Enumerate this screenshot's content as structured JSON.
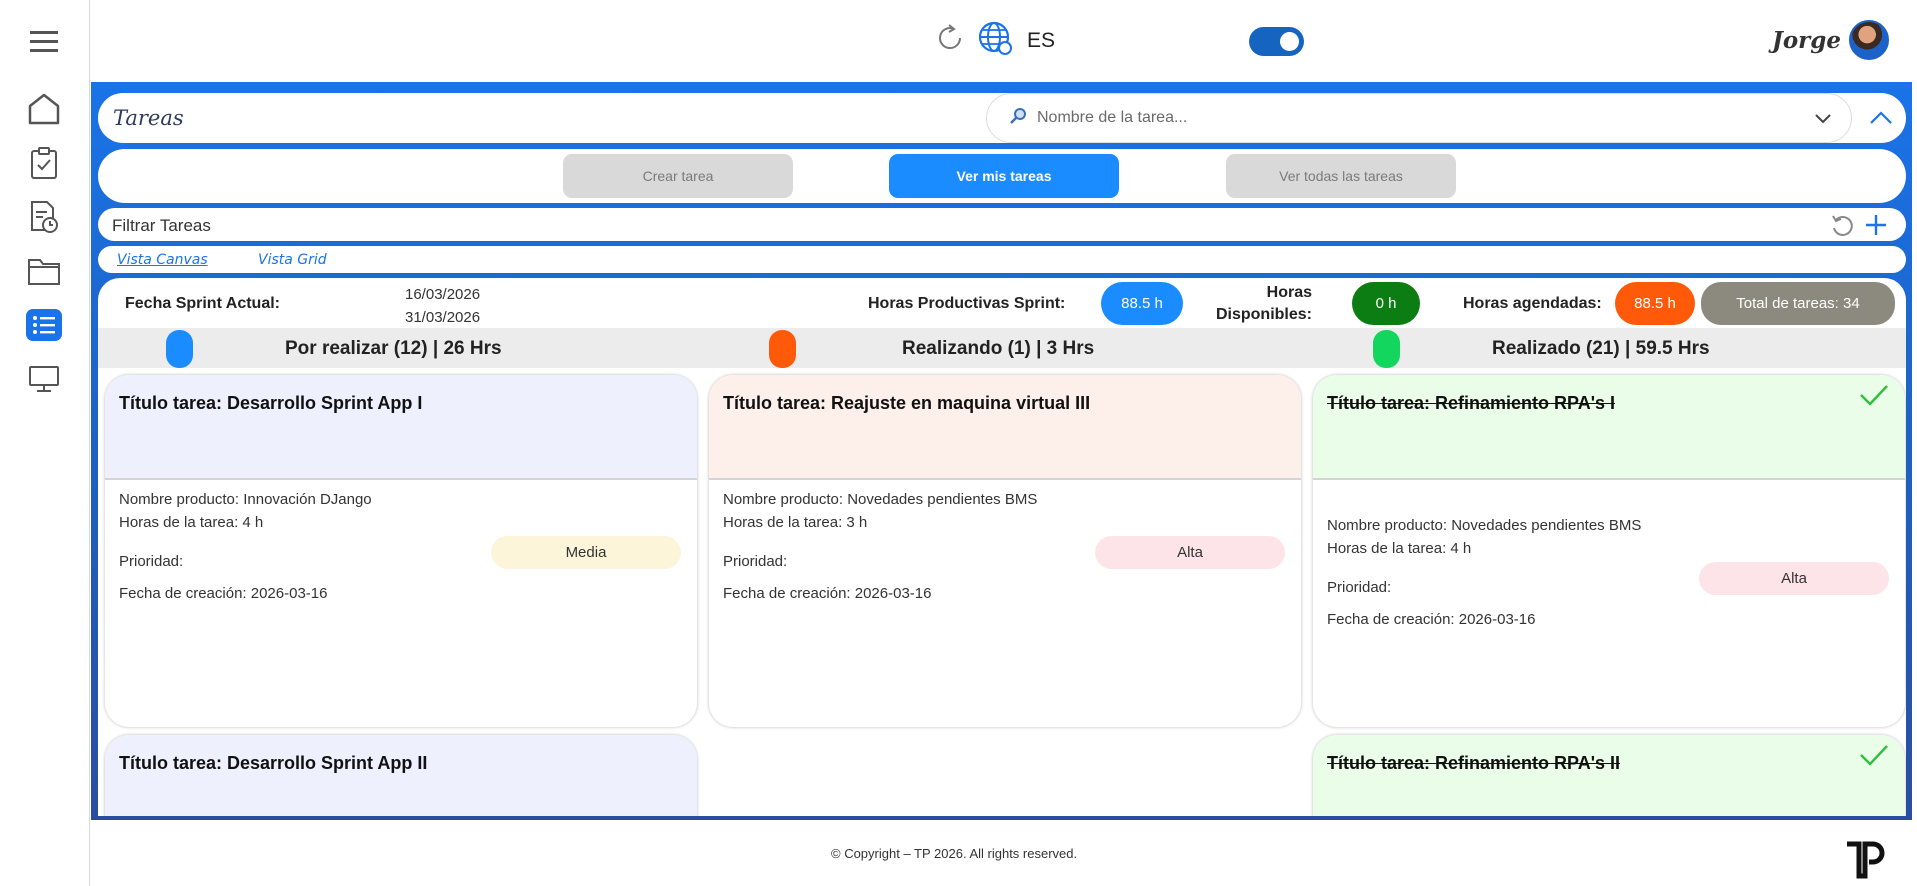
{
  "topbar": {
    "language": "ES",
    "user_name": "Jorge"
  },
  "sidebar": {
    "items": [
      {
        "name": "menu-icon"
      },
      {
        "name": "home-icon"
      },
      {
        "name": "clipboard-check-icon"
      },
      {
        "name": "document-clock-icon"
      },
      {
        "name": "folder-icon"
      },
      {
        "name": "list-icon",
        "active": true
      },
      {
        "name": "monitor-icon"
      }
    ]
  },
  "page": {
    "title": "Tareas",
    "search_placeholder": "Nombre de la tarea..."
  },
  "actions": {
    "create": "Crear tarea",
    "mine": "Ver mis tareas",
    "all": "Ver todas las tareas"
  },
  "filter": {
    "label": "Filtrar Tareas"
  },
  "views": {
    "canvas": "Vista Canvas",
    "grid": "Vista Grid"
  },
  "stats": {
    "sprint_label": "Fecha Sprint Actual:",
    "sprint_start": "16/03/2026",
    "sprint_end": "31/03/2026",
    "productive_label": "Horas Productivas Sprint:",
    "productive_value": "88.5 h",
    "available_label_1": "Horas",
    "available_label_2": "Disponibles:",
    "available_value": "0 h",
    "scheduled_label": "Horas agendadas:",
    "scheduled_value": "88.5 h",
    "total_tasks": "Total de tareas: 34"
  },
  "columns": [
    {
      "title": "Por realizar (12) | 26 Hrs",
      "color": "#1a8cff"
    },
    {
      "title": "Realizando (1) | 3 Hrs",
      "color": "#ff5a0a"
    },
    {
      "title": "Realizado (21) | 59.5 Hrs",
      "color": "#12d65e"
    }
  ],
  "cards": [
    {
      "title": "Título tarea: Desarrollo Sprint App I",
      "product": "Nombre producto: Innovación DJango",
      "hours": "Horas de la tarea: 4 h",
      "priority_label": "Prioridad:",
      "priority": "Media",
      "created": "Fecha de creación: 2026-03-16",
      "head_color": "#eef1fd",
      "priority_color": "#fdf5da"
    },
    {
      "title": "Título tarea: Reajuste en maquina virtual III",
      "product": "Nombre producto: Novedades pendientes BMS",
      "hours": "Horas de la tarea: 3 h",
      "priority_label": "Prioridad:",
      "priority": "Alta",
      "created": "Fecha de creación: 2026-03-16",
      "head_color": "#fdf0ea",
      "priority_color": "#fde4e8"
    },
    {
      "title": "Título tarea: Refinamiento RPA's I",
      "product": "Nombre producto: Novedades pendientes BMS",
      "hours": "Horas de la tarea: 4 h",
      "priority_label": "Prioridad:",
      "priority": "Alta",
      "created": "Fecha de creación: 2026-03-16",
      "head_color": "#eafde9",
      "priority_color": "#fde4e8"
    },
    {
      "title": "Título tarea: Desarrollo Sprint App II",
      "head_color": "#eef1fd"
    },
    {
      "title": "Título tarea: Refinamiento RPA's II",
      "head_color": "#eafde9"
    }
  ],
  "footer": {
    "copyright": "© Copyright – TP 2026. All rights reserved."
  }
}
